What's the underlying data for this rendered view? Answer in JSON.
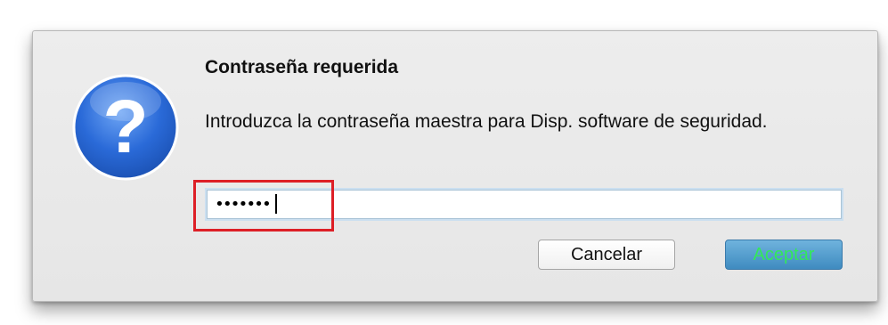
{
  "dialog": {
    "title": "Contraseña requerida",
    "message": "Introduzca la contraseña maestra para Disp. software de seguridad.",
    "icon": "question-icon",
    "password_value": "•••••••",
    "buttons": {
      "cancel": "Cancelar",
      "accept": "Aceptar"
    }
  },
  "colors": {
    "dialog_bg": "#ececec",
    "icon_blue": "#2a6ad8",
    "accept_bg": "#4f9bcd",
    "accept_text": "#33e85a",
    "highlight": "#dd1f26"
  }
}
